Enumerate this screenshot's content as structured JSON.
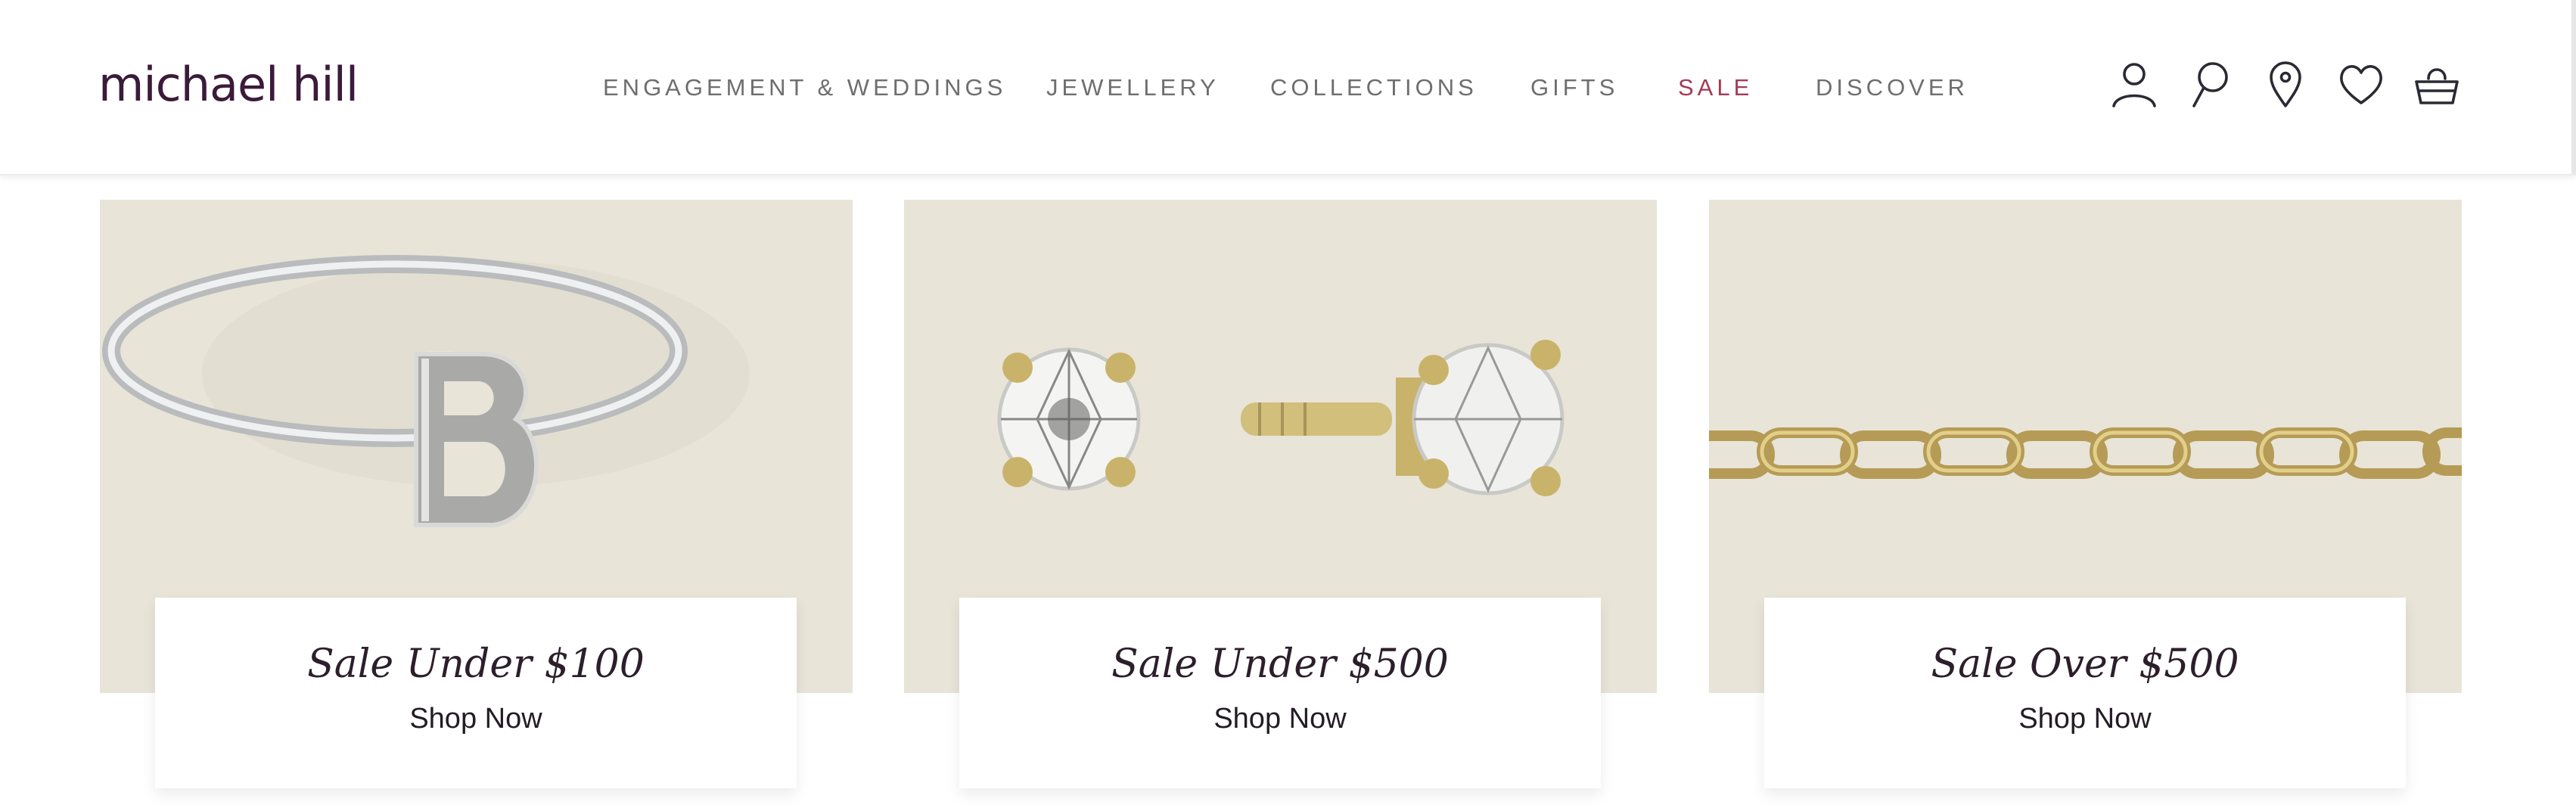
{
  "brand": {
    "name": "michael hill"
  },
  "nav": {
    "items": [
      {
        "label": "ENGAGEMENT & WEDDINGS"
      },
      {
        "label": "JEWELLERY"
      },
      {
        "label": "COLLECTIONS"
      },
      {
        "label": "GIFTS"
      },
      {
        "label": "SALE"
      },
      {
        "label": "DISCOVER"
      }
    ],
    "sale_color": "#a33a56"
  },
  "header_icons": [
    "account-icon",
    "search-icon",
    "store-locator-icon",
    "wishlist-icon",
    "basket-icon"
  ],
  "cards": [
    {
      "title": "Sale Under $100",
      "cta": "Shop Now",
      "image": "initial-ring"
    },
    {
      "title": "Sale Under $500",
      "cta": "Shop Now",
      "image": "diamond-stud-earrings"
    },
    {
      "title": "Sale Over $500",
      "cta": "Shop Now",
      "image": "gold-chain"
    }
  ],
  "colors": {
    "card_bg": "#e8e4d8",
    "brand": "#3b1a3a"
  }
}
